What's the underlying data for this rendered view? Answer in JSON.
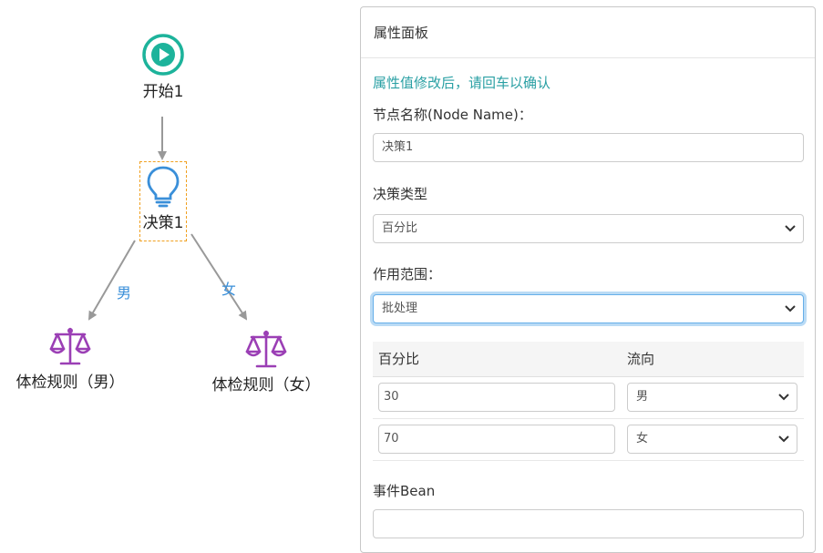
{
  "canvas": {
    "nodes": {
      "start": {
        "label": "开始1",
        "icon": "play-circle-icon",
        "color": "#1db39b"
      },
      "decision": {
        "label": "决策1",
        "icon": "lightbulb-icon",
        "color": "#3a8fd9",
        "selected_border": "#f0a020"
      },
      "rule_male": {
        "label": "体检规则（男）",
        "icon": "scales-icon",
        "color": "#9b3fb5"
      },
      "rule_female": {
        "label": "体检规则（女）",
        "icon": "scales-icon",
        "color": "#9b3fb5"
      }
    },
    "edges": {
      "male_label": "男",
      "female_label": "女"
    }
  },
  "panel": {
    "title": "属性面板",
    "hint": "属性值修改后，请回车以确认",
    "node_name_label": "节点名称(Node Name)：",
    "node_name_value": "决策1",
    "decision_type_label": "决策类型",
    "decision_type_value": "百分比",
    "scope_label": "作用范围：",
    "scope_value": "批处理",
    "table": {
      "headers": [
        "百分比",
        "流向"
      ],
      "rows": [
        {
          "percent": "30",
          "flow": "男"
        },
        {
          "percent": "70",
          "flow": "女"
        }
      ]
    },
    "event_bean_label": "事件Bean",
    "event_bean_value": ""
  }
}
